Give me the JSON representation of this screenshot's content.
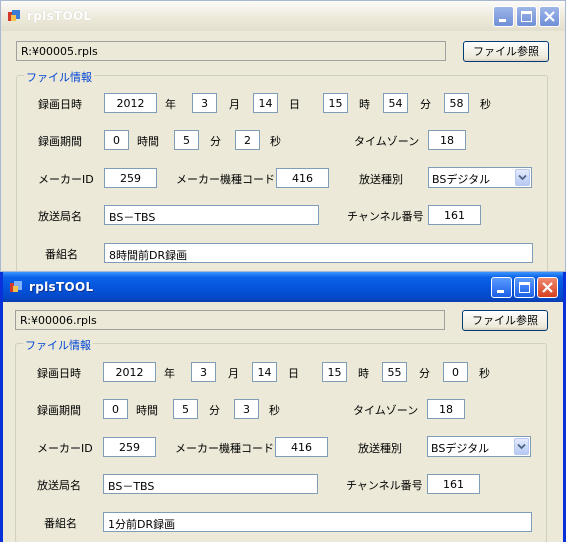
{
  "windows": [
    {
      "title": "rplsTOOL",
      "path": "R:¥00005.rpls",
      "browse_label": "ファイル参照",
      "group_label": "ファイル情報",
      "labels": {
        "rec_datetime": "録画日時",
        "year": "年",
        "month": "月",
        "day": "日",
        "hour": "時",
        "minute": "分",
        "second": "秒",
        "duration": "録画期間",
        "dur_hour": "時間",
        "dur_min": "分",
        "dur_sec": "秒",
        "timezone": "タイムゾーン",
        "maker_id": "メーカーID",
        "model_code": "メーカー機種コード",
        "broadcast_type": "放送種別",
        "station": "放送局名",
        "channel": "チャンネル番号",
        "program": "番組名"
      },
      "values": {
        "year": "2012",
        "month": "3",
        "day": "14",
        "hour": "15",
        "minute": "54",
        "second": "58",
        "dur_hour": "0",
        "dur_min": "5",
        "dur_sec": "2",
        "timezone": "18",
        "maker_id": "259",
        "model_code": "416",
        "broadcast_type": "BSデジタル",
        "station": "BS－TBS",
        "channel": "161",
        "program": "8時間前DR録画"
      }
    },
    {
      "title": "rplsTOOL",
      "path": "R:¥00006.rpls",
      "browse_label": "ファイル参照",
      "group_label": "ファイル情報",
      "labels": {
        "rec_datetime": "録画日時",
        "year": "年",
        "month": "月",
        "day": "日",
        "hour": "時",
        "minute": "分",
        "second": "秒",
        "duration": "録画期間",
        "dur_hour": "時間",
        "dur_min": "分",
        "dur_sec": "秒",
        "timezone": "タイムゾーン",
        "maker_id": "メーカーID",
        "model_code": "メーカー機種コード",
        "broadcast_type": "放送種別",
        "station": "放送局名",
        "channel": "チャンネル番号",
        "program": "番組名"
      },
      "values": {
        "year": "2012",
        "month": "3",
        "day": "14",
        "hour": "15",
        "minute": "55",
        "second": "0",
        "dur_hour": "0",
        "dur_min": "5",
        "dur_sec": "3",
        "timezone": "18",
        "maker_id": "259",
        "model_code": "416",
        "broadcast_type": "BSデジタル",
        "station": "BS－TBS",
        "channel": "161",
        "program": "1分前DR録画"
      }
    }
  ],
  "icons": {
    "app": "rplstool-app-icon",
    "minimize": "minimize-icon",
    "maximize": "maximize-icon",
    "close": "close-icon",
    "dropdown": "chevron-down-icon"
  },
  "colors": {
    "active_title": "#0555dc",
    "group_label": "#0046d5",
    "window_bg": "#ece9d8",
    "close_button": "#d4401f"
  }
}
